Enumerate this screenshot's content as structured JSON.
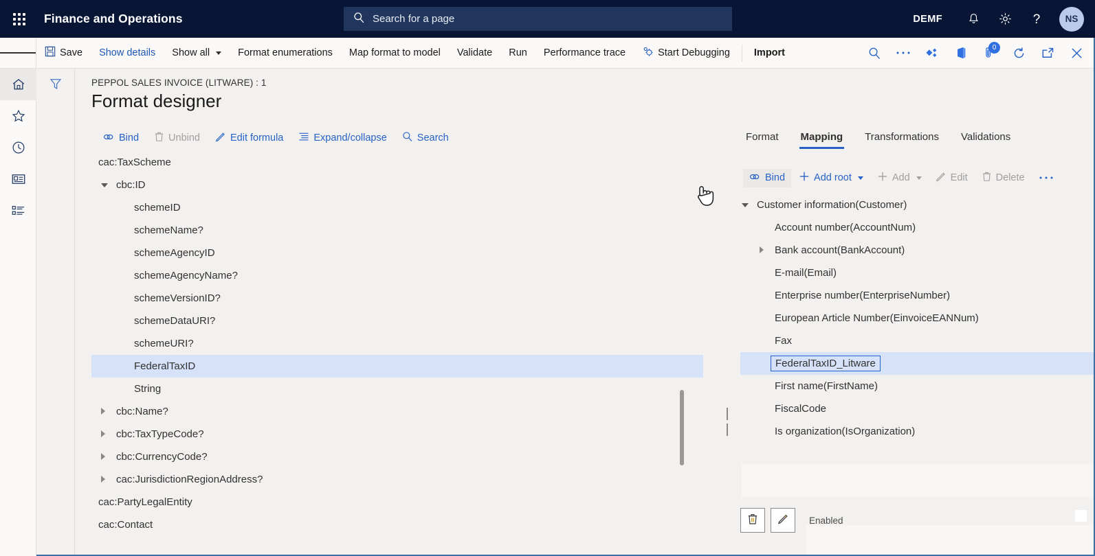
{
  "topnav": {
    "waffle_icon": "waffle-grid-icon",
    "brand": "Finance and Operations",
    "search": {
      "icon": "search-icon",
      "placeholder": "Search for a page",
      "value": ""
    },
    "company": "DEMF",
    "icons": [
      "bell-icon",
      "gear-icon",
      "help-icon"
    ],
    "avatar_initials": "NS",
    "bg_color": "#081535",
    "search_bg": "#20365c"
  },
  "commandbar": {
    "menu_icon": "hamburger-icon",
    "items": [
      {
        "label": "Save",
        "icon": "save-icon",
        "style": "plain"
      },
      {
        "label": "Show details",
        "icon": "",
        "style": "link"
      },
      {
        "label": "Show all",
        "icon": "chevron-down-icon",
        "style": "plain"
      },
      {
        "label": "Format enumerations",
        "icon": "",
        "style": "plain"
      },
      {
        "label": "Map format to model",
        "icon": "",
        "style": "plain"
      },
      {
        "label": "Validate",
        "icon": "",
        "style": "plain"
      },
      {
        "label": "Run",
        "icon": "",
        "style": "plain"
      },
      {
        "label": "Performance trace",
        "icon": "",
        "style": "plain"
      },
      {
        "label": "Start Debugging",
        "icon": "debug-icon",
        "style": "plain"
      },
      {
        "label": "Import",
        "icon": "",
        "style": "bold"
      }
    ],
    "right_icons": [
      {
        "name": "search-icon",
        "badge": ""
      },
      {
        "name": "overflow-ellipsis-icon",
        "badge": ""
      },
      {
        "name": "share-diamond-icon",
        "badge": ""
      },
      {
        "name": "office-icon",
        "badge": ""
      },
      {
        "name": "attachments-icon",
        "badge": "0"
      },
      {
        "name": "refresh-icon",
        "badge": ""
      },
      {
        "name": "popout-icon",
        "badge": ""
      },
      {
        "name": "close-icon",
        "badge": ""
      }
    ],
    "accent_color": "#2661c6"
  },
  "leftrail": {
    "items": [
      {
        "name": "home-icon",
        "active": true
      },
      {
        "name": "favorites-star-icon",
        "active": false
      },
      {
        "name": "recent-clock-icon",
        "active": false
      },
      {
        "name": "workspaces-icon",
        "active": false
      },
      {
        "name": "modules-list-icon",
        "active": false
      }
    ]
  },
  "page": {
    "filter_icon": "filter-funnel-icon",
    "breadcrumb": "PEPPOL SALES INVOICE (LITWARE) : 1",
    "title": "Format designer"
  },
  "left_toolbar": {
    "buttons": [
      {
        "label": "Bind",
        "icon": "bind-link-icon",
        "disabled": false
      },
      {
        "label": "Unbind",
        "icon": "unbind-trash-icon",
        "disabled": true
      },
      {
        "label": "Edit formula",
        "icon": "pencil-icon",
        "disabled": false
      },
      {
        "label": "Expand/collapse",
        "icon": "list-lines-icon",
        "disabled": false
      },
      {
        "label": "Search",
        "icon": "search-icon",
        "disabled": false
      }
    ]
  },
  "left_tree": {
    "rows": [
      {
        "label": "cac:TaxScheme",
        "indent": 0,
        "toggle": "down",
        "selected": false
      },
      {
        "label": "cbc:ID",
        "indent": 1,
        "toggle": "down",
        "selected": false
      },
      {
        "label": "schemeID",
        "indent": 2,
        "toggle": "none",
        "selected": false
      },
      {
        "label": "schemeName?",
        "indent": 2,
        "toggle": "none",
        "selected": false
      },
      {
        "label": "schemeAgencyID",
        "indent": 2,
        "toggle": "none",
        "selected": false
      },
      {
        "label": "schemeAgencyName?",
        "indent": 2,
        "toggle": "none",
        "selected": false
      },
      {
        "label": "schemeVersionID?",
        "indent": 2,
        "toggle": "none",
        "selected": false
      },
      {
        "label": "schemeDataURI?",
        "indent": 2,
        "toggle": "none",
        "selected": false
      },
      {
        "label": "schemeURI?",
        "indent": 2,
        "toggle": "none",
        "selected": false
      },
      {
        "label": "FederalTaxID",
        "indent": 2,
        "toggle": "none",
        "selected": true
      },
      {
        "label": "String",
        "indent": 2,
        "toggle": "none",
        "selected": false
      },
      {
        "label": "cbc:Name?",
        "indent": 1,
        "toggle": "right",
        "selected": false
      },
      {
        "label": "cbc:TaxTypeCode?",
        "indent": 1,
        "toggle": "right",
        "selected": false
      },
      {
        "label": "cbc:CurrencyCode?",
        "indent": 1,
        "toggle": "right",
        "selected": false
      },
      {
        "label": "cac:JurisdictionRegionAddress?",
        "indent": 1,
        "toggle": "right",
        "selected": false
      },
      {
        "label": "cac:PartyLegalEntity",
        "indent": 0,
        "toggle": "right",
        "selected": false
      },
      {
        "label": "cac:Contact",
        "indent": 0,
        "toggle": "right",
        "selected": false
      }
    ],
    "selection_color": "#d6e2fa"
  },
  "right_panel": {
    "tabs": [
      {
        "label": "Format",
        "active": false
      },
      {
        "label": "Mapping",
        "active": true
      },
      {
        "label": "Transformations",
        "active": false
      },
      {
        "label": "Validations",
        "active": false
      }
    ],
    "toolbar": [
      {
        "label": "Bind",
        "icon": "bind-link-icon",
        "disabled": false,
        "hover": true,
        "chevron": false
      },
      {
        "label": "Add root",
        "icon": "plus-icon",
        "disabled": false,
        "hover": false,
        "chevron": true
      },
      {
        "label": "Add",
        "icon": "plus-icon",
        "disabled": true,
        "hover": false,
        "chevron": true
      },
      {
        "label": "Edit",
        "icon": "pencil-icon",
        "disabled": true,
        "hover": false,
        "chevron": false
      },
      {
        "label": "Delete",
        "icon": "trash-icon",
        "disabled": true,
        "hover": false,
        "chevron": false
      },
      {
        "label": "…",
        "icon": "overflow-ellipsis-icon",
        "disabled": false,
        "hover": false,
        "chevron": false
      }
    ],
    "tree": [
      {
        "label": "Customer information(Customer)",
        "indent": 0,
        "toggle": "down",
        "selected": false,
        "boxed": false
      },
      {
        "label": "Account number(AccountNum)",
        "indent": 1,
        "toggle": "none",
        "selected": false,
        "boxed": false
      },
      {
        "label": "Bank account(BankAccount)",
        "indent": 1,
        "toggle": "right",
        "selected": false,
        "boxed": false
      },
      {
        "label": "E-mail(Email)",
        "indent": 1,
        "toggle": "none",
        "selected": false,
        "boxed": false
      },
      {
        "label": "Enterprise number(EnterpriseNumber)",
        "indent": 1,
        "toggle": "none",
        "selected": false,
        "boxed": false
      },
      {
        "label": "European Article Number(EinvoiceEANNum)",
        "indent": 1,
        "toggle": "none",
        "selected": false,
        "boxed": false
      },
      {
        "label": "Fax",
        "indent": 1,
        "toggle": "none",
        "selected": false,
        "boxed": false
      },
      {
        "label": "FederalTaxID_Litware",
        "indent": 1,
        "toggle": "none",
        "selected": true,
        "boxed": true
      },
      {
        "label": "First name(FirstName)",
        "indent": 1,
        "toggle": "none",
        "selected": false,
        "boxed": false
      },
      {
        "label": "FiscalCode",
        "indent": 1,
        "toggle": "none",
        "selected": false,
        "boxed": false
      },
      {
        "label": "Is organization(IsOrganization)",
        "indent": 1,
        "toggle": "none",
        "selected": false,
        "boxed": false
      }
    ],
    "footer": {
      "delete_icon": "trash-icon",
      "edit_icon": "pencil-icon",
      "enabled_label": "Enabled",
      "enabled_value": ""
    }
  },
  "cursor": {
    "type": "pointing-hand-cursor"
  }
}
